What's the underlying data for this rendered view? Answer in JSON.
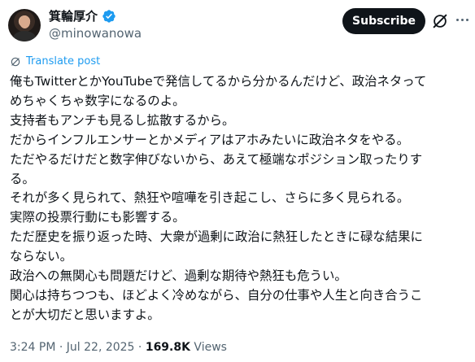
{
  "author": {
    "display_name": "箕輪厚介",
    "handle": "@minowanowa"
  },
  "actions": {
    "subscribe_label": "Subscribe"
  },
  "translate": {
    "label": "Translate post"
  },
  "post": {
    "lines": [
      "俺もTwitterとかYouTubeで発信してるから分かるんだけど、政治ネタって",
      "めちゃくちゃ数字になるのよ。",
      "支持者もアンチも見るし拡散するから。",
      "だからインフルエンサーとかメディアはアホみたいに政治ネタをやる。",
      "ただやるだけだと数字伸びないから、あえて極端なポジション取ったりす",
      "る。",
      "それが多く見られて、熱狂や喧嘩を引き起こし、さらに多く見られる。",
      "実際の投票行動にも影響する。",
      "ただ歴史を振り返った時、大衆が過剰に政治に熱狂したときに碌な結果に",
      "ならない。",
      "政治への無関心も問題だけど、過剰な期待や熱狂も危うい。",
      "関心は持ちつつも、ほどよく冷めながら、自分の仕事や人生と向き合うこ",
      "とが大切だと思いますよ。"
    ]
  },
  "meta": {
    "time": "3:24 PM",
    "separator": "·",
    "date": "Jul 22, 2025",
    "views_count": "169.8K",
    "views_label": "Views"
  },
  "colors": {
    "verified": "#1d9bf0",
    "link": "#1d9bf0",
    "text": "#0f1419",
    "secondary": "#536471",
    "button_bg": "#0f1419"
  },
  "icons": {
    "verified": "verified-badge-icon",
    "grok": "grok-icon",
    "more": "more-icon",
    "translate": "translate-icon"
  }
}
